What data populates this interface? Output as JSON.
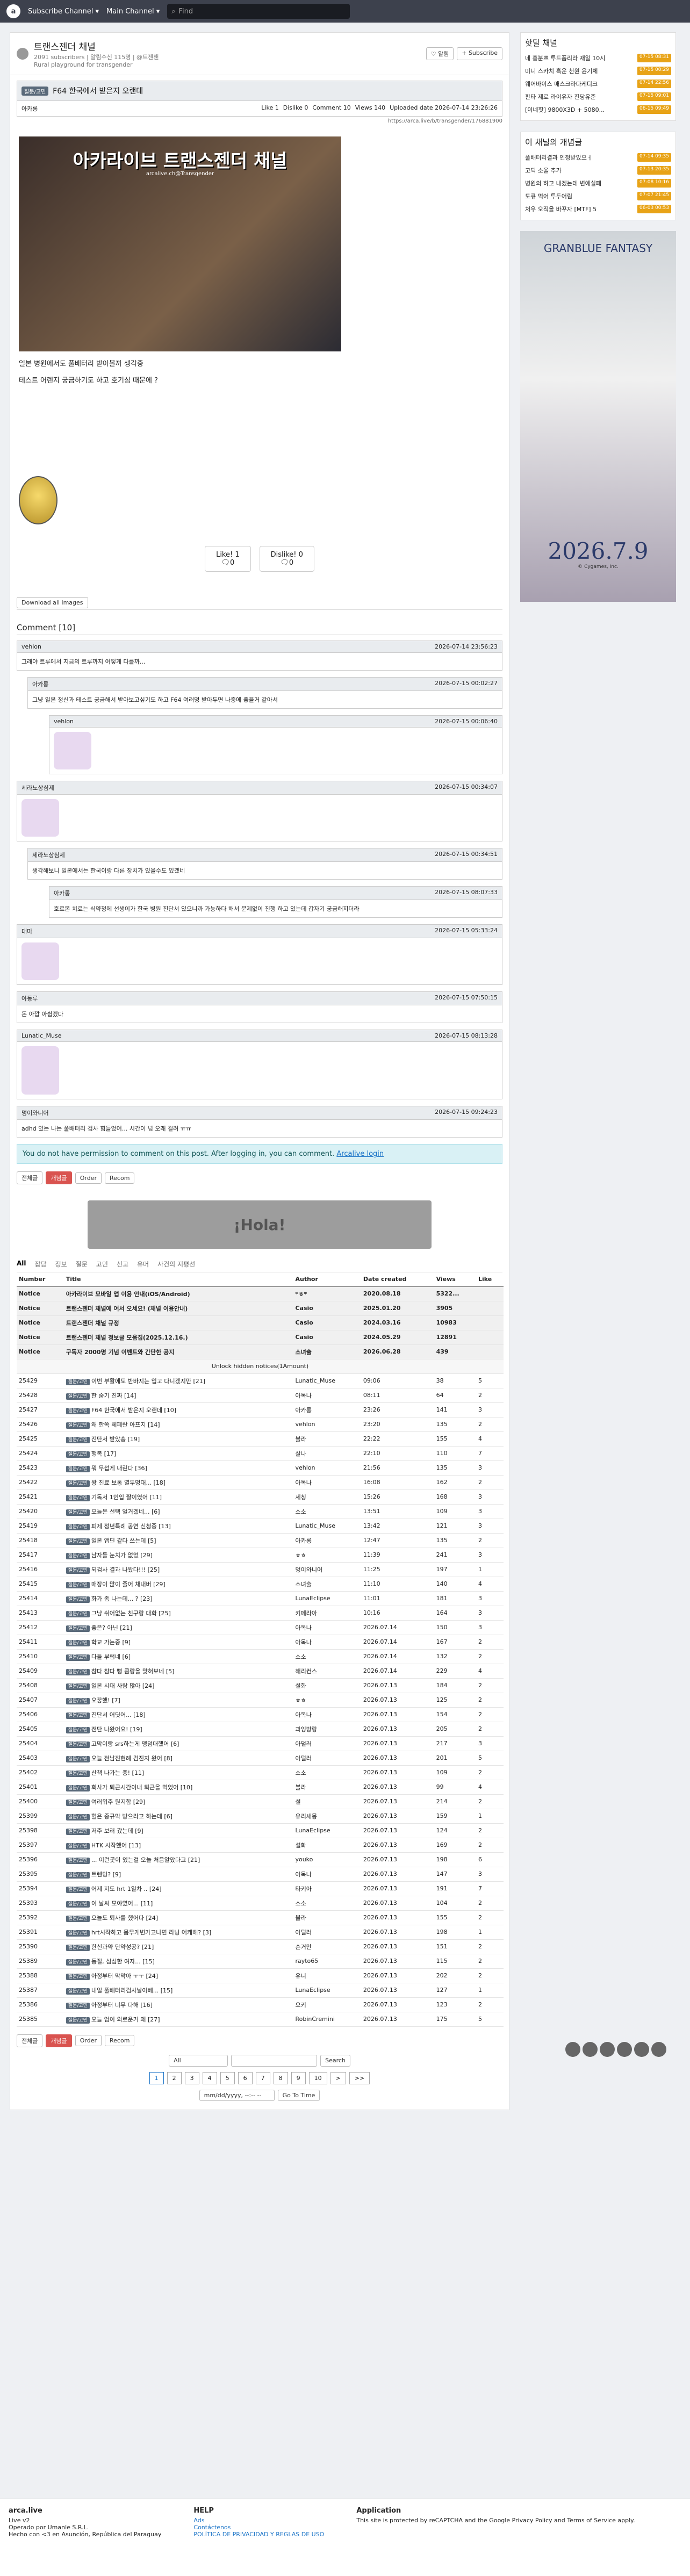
{
  "topbar": {
    "logo": "a",
    "subscribe_channel": "Subscribe Channel ▾",
    "main_channel": "Main Channel ▾",
    "search_placeholder": "Find"
  },
  "channel": {
    "name": "트랜스젠더 채널",
    "meta": "2091 subscribers | 알림수신 115명 | @트젠챈",
    "desc": "Rural playground for transgender",
    "alert_btn": "♡ 알림",
    "subscribe_btn": "+ Subscribe"
  },
  "post": {
    "badge": "질문/고민",
    "title": "F64 한국에서 받은지 오랜데",
    "author": "아카롱",
    "like": "Like 1",
    "dislike": "Dislike 0",
    "comments": "Comment 10",
    "views": "Views 140",
    "uploaded": "Uploaded date 2026-07-14 23:26:26",
    "url": "https://arca.live/b/transgender/176881900",
    "hero_title": "아카라이브 트랜스젠더 채널",
    "hero_sub": "arcalive.ch@Transgender",
    "line1": "일본 병원에서도 풀배터리 받아볼까 생각중",
    "line2": "테스트 어렌지 궁금하기도 하고 호기심 때문에 ?",
    "like_btn": "Like! 1",
    "like_sub": "🗨0",
    "dislike_btn": "Dislike! 0",
    "dislike_sub": "🗨0",
    "download": "Download all images"
  },
  "comment_header": "Comment [10]",
  "comments": [
    {
      "user": "vehlon",
      "time": "2026-07-14 23:56:23",
      "text": "그래야 트루에서 지금의 트루까지 어떻게 다를까..."
    },
    {
      "user": "아카롱",
      "time": "2026-07-15 00:02:27",
      "text": "그냥 일본 정신과 테스트 궁금해서 받아보고싶기도 하고 F64 여러명 받아두면 나중에 좋을거 같아서"
    },
    {
      "user": "vehlon",
      "time": "2026-07-15 00:06:40",
      "text": ""
    },
    {
      "user": "세라노상심제",
      "time": "2026-07-15 00:34:07",
      "text": ""
    },
    {
      "user": "세라노상심제",
      "time": "2026-07-15 00:34:51",
      "text": "생각해보니 일본에서는 한국이랑 다른 장치가 있을수도 있겠네"
    },
    {
      "user": "아카롱",
      "time": "2026-07-15 08:07:33",
      "text": "호르몬 치료는 식약청에 선생이가 한국 병원 진단서 있으니까 가능하다 해서 문제없이 진행 하고 있는데 갑자기 궁금해지더라"
    },
    {
      "user": "대마",
      "time": "2026-07-15 05:33:24",
      "text": ""
    },
    {
      "user": "아동루",
      "time": "2026-07-15 07:50:15",
      "text": "돈 아깝 아쉽겠다"
    },
    {
      "user": "Lunatic_Muse",
      "time": "2026-07-15 08:13:28",
      "text": ""
    },
    {
      "user": "멍이와니어",
      "time": "2026-07-15 09:24:23",
      "text": "adhd 있는 나는 풀배터리 검사 힘들었어... 시간이 넘 오래 걸려 ㅠㅠ"
    }
  ],
  "perm_notice": "You do not have permission to comment on this post. After logging in, you can comment.",
  "perm_link": "Arcalive login",
  "toolbar": {
    "all": "전체글",
    "best": "개념글",
    "order": "Order",
    "recom": "Recom"
  },
  "banner": "¡Hola!",
  "tabs": [
    "All",
    "잡담",
    "정보",
    "질문",
    "고민",
    "신고",
    "유머",
    "사건의 지평선"
  ],
  "table_head": {
    "number": "Number",
    "title": "Title",
    "author": "Author",
    "date": "Date created",
    "views": "Views",
    "like": "Like"
  },
  "notices": [
    {
      "n": "Notice",
      "t": "아카라이브 모바일 앱 이용 안내(iOS/Android)",
      "a": "*ㅎ*",
      "d": "2020.08.18",
      "v": "5322...",
      "l": ""
    },
    {
      "n": "Notice",
      "t": "트랜스젠더 채널에 어서 오세요! (채널 이용안내)",
      "a": "Casio",
      "d": "2025.01.20",
      "v": "3905",
      "l": ""
    },
    {
      "n": "Notice",
      "t": "트랜스젠더 채널 규정",
      "a": "Casio",
      "d": "2024.03.16",
      "v": "10983",
      "l": ""
    },
    {
      "n": "Notice",
      "t": "트랜스젠더 채널 정보글 모음집(2025.12.16.)",
      "a": "Casio",
      "d": "2024.05.29",
      "v": "12891",
      "l": ""
    },
    {
      "n": "Notice",
      "t": "구독자 2000명 기념 이벤트와 간단한 공지",
      "a": "소녀술",
      "d": "2026.06.28",
      "v": "439",
      "l": ""
    }
  ],
  "hidden_notice": "Unlock hidden notices(1Amount)",
  "rows": [
    [
      "25429",
      "이번 부활에도 반바지는 입고 다니겠지만 [21]",
      "Lunatic_Muse",
      "09:06",
      "38",
      "5"
    ],
    [
      "25428",
      "한 숨기 진짜 [14]",
      "아목나",
      "08:11",
      "64",
      "2"
    ],
    [
      "25427",
      "F64 한국에서 받은지 오랜데 [10]",
      "아카롱",
      "23:26",
      "141",
      "3"
    ],
    [
      "25426",
      "왜 한쪽 체페란 아프지 [14]",
      "vehlon",
      "23:20",
      "135",
      "2"
    ],
    [
      "25425",
      "진단서 받았숑 [19]",
      "블라",
      "22:22",
      "155",
      "4"
    ],
    [
      "25424",
      "행복 [17]",
      "살나",
      "22:10",
      "110",
      "7"
    ],
    [
      "25423",
      "뭐 무섭게 내린다 [36]",
      "vehlon",
      "21:56",
      "135",
      "3"
    ],
    [
      "25422",
      "왕 진료 보통 열두명대... [18]",
      "아목나",
      "16:08",
      "162",
      "2"
    ],
    [
      "25421",
      "기독서 1인입 짤이였어 [11]",
      "세칭",
      "15:26",
      "168",
      "3"
    ],
    [
      "25420",
      "오늘은 선택 얼거겠네... [6]",
      "소소",
      "13:51",
      "109",
      "3"
    ],
    [
      "25419",
      "피제 정년특례 공연 신청중 [13]",
      "Lunatic_Muse",
      "13:42",
      "121",
      "3"
    ],
    [
      "25418",
      "일본 앱딘 같다 쓰는데 [5]",
      "아카롱",
      "12:47",
      "135",
      "2"
    ],
    [
      "25417",
      "남자들 눈치가 없었 [29]",
      "ㅎㅎ",
      "11:39",
      "241",
      "3"
    ],
    [
      "25416",
      "되검사 결과 나왔다!!! [25]",
      "멍이와니어",
      "11:25",
      "197",
      "1"
    ],
    [
      "25415",
      "매장이 많이 줄어 채내버 [29]",
      "소녀술",
      "11:10",
      "140",
      "4"
    ],
    [
      "25414",
      "화가 좀 나는데... ? [23]",
      "LunaEclipse",
      "11:01",
      "181",
      "3"
    ],
    [
      "25413",
      "그냥 쉬어없는 친구랑 대화 [25]",
      "키메라아",
      "10:16",
      "164",
      "3"
    ],
    [
      "25412",
      "좋은? 아닌 [21]",
      "아목나",
      "2026.07.14",
      "150",
      "3"
    ],
    [
      "25411",
      "학교 가는중 [9]",
      "아목나",
      "2026.07.14",
      "167",
      "2"
    ],
    [
      "25410",
      "다들 부럽네 [6]",
      "소소",
      "2026.07.14",
      "132",
      "2"
    ],
    [
      "25409",
      "참다 참다 뻥 큼랑을 맞혀보네 [5]",
      "해리컨스",
      "2026.07.14",
      "229",
      "4"
    ],
    [
      "25408",
      "일본 시대 사람 많아 [24]",
      "설화",
      "2026.07.13",
      "184",
      "2"
    ],
    [
      "25407",
      "오꿍했! [7]",
      "ㅎㅎ",
      "2026.07.13",
      "125",
      "2"
    ],
    [
      "25406",
      "진단서 어딧어... [18]",
      "아목나",
      "2026.07.13",
      "154",
      "2"
    ],
    [
      "25405",
      "전단 나왔어요! [19]",
      "과잉방랑",
      "2026.07.13",
      "205",
      "2"
    ],
    [
      "25404",
      "고막이랑 srs하는게 맹덤대했어 [6]",
      "아덜러",
      "2026.07.13",
      "217",
      "3"
    ],
    [
      "25403",
      "오늘 전남진현례 검진지 왔어 [8]",
      "아덜러",
      "2026.07.13",
      "201",
      "5"
    ],
    [
      "25402",
      "산책 나가는 중! [11]",
      "소소",
      "2026.07.13",
      "109",
      "2"
    ],
    [
      "25401",
      "회사가 퇴근시간이내 퇴근을 먹었어 [10]",
      "블라",
      "2026.07.13",
      "99",
      "4"
    ],
    [
      "25400",
      "여러워주 뭔지함 [29]",
      "설",
      "2026.07.13",
      "214",
      "2"
    ],
    [
      "25399",
      "혈은 중규막 방으라고 하는데 [6]",
      "유리새몽",
      "2026.07.13",
      "159",
      "1"
    ],
    [
      "25398",
      "저주 보러 갔는데 [9]",
      "LunaEclipse",
      "2026.07.13",
      "124",
      "2"
    ],
    [
      "25397",
      "HTK 시작했어 [13]",
      "설화",
      "2026.07.13",
      "169",
      "2"
    ],
    [
      "25396",
      "... 이런곳이 있는걸 오늘 처음알았다고 [21]",
      "youko",
      "2026.07.13",
      "198",
      "6"
    ],
    [
      "25395",
      "트렌딩? [9]",
      "아목나",
      "2026.07.13",
      "147",
      "3"
    ],
    [
      "25394",
      "어제 지도 hrt 1일차 .. [24]",
      "타키아",
      "2026.07.13",
      "191",
      "7"
    ],
    [
      "25393",
      "이 날씨 모야였어... [11]",
      "소소",
      "2026.07.13",
      "104",
      "2"
    ],
    [
      "25392",
      "오늘도 퇴사를 했어다 [24]",
      "블라",
      "2026.07.13",
      "155",
      "2"
    ],
    [
      "25391",
      "hrt시작하고 몸무게변가고나면 라닝 어케해? [3]",
      "아덜러",
      "2026.07.13",
      "198",
      "1"
    ],
    [
      "25390",
      "한신과약 단약성공? [21]",
      "손거만",
      "2026.07.13",
      "151",
      "2"
    ],
    [
      "25389",
      "동질, 심심한 여자... [15]",
      "rayto65",
      "2026.07.13",
      "115",
      "2"
    ],
    [
      "25388",
      "아정부터 막막아 ㅜㅜ [24]",
      "유니",
      "2026.07.13",
      "202",
      "2"
    ],
    [
      "25387",
      "내일 풀배터리검사날아베... [15]",
      "LunaEclipse",
      "2026.07.13",
      "127",
      "1"
    ],
    [
      "25386",
      "아정부터 너무 다해 [16]",
      "오키",
      "2026.07.13",
      "123",
      "2"
    ],
    [
      "25385",
      "오늘 엄이 외로운거 왜 [27]",
      "RobinCremini",
      "2026.07.13",
      "175",
      "5"
    ]
  ],
  "search_scope": "All",
  "search_btn": "Search",
  "pages": [
    "1",
    "2",
    "3",
    "4",
    "5",
    "6",
    "7",
    "8",
    "9",
    "10",
    ">",
    ">>"
  ],
  "date_placeholder": "mm/dd/yyyy, --:-- --",
  "goto_btn": "Go To Time",
  "footer": {
    "brand": "arca.live",
    "live": "Live v2",
    "operated": "Operado por Umanle S.R.L.",
    "made": "Hecho con <3 en Asunción, República del Paraguay",
    "help": "HELP",
    "ads": "Ads",
    "contact": "Contáctenos",
    "policy": "POLÍTICA DE PRIVACIDAD Y REGLAS DE USO",
    "application": "Application",
    "recaptcha": "This site is protected by reCAPTCHA and the Google Privacy Policy and Terms of Service apply."
  },
  "side": {
    "hot_title": "핫딜 채널",
    "hot": [
      [
        "네 흥분쁘 투드폼리라 재일 10시",
        "07-15 08:31"
      ],
      [
        "미니 스카치 흑운 천원 윤기체",
        "07-15 00:29"
      ],
      [
        "웨어바이스 매스크라다케디크",
        "07-14 22:56"
      ],
      [
        "판타 제로 라이유자 진당유준",
        "07-15 09:01"
      ],
      [
        "[이네핫] 9800X3D + 5080...",
        "06-15 09:49"
      ]
    ],
    "best_title": "이 채널의 개념글",
    "best": [
      [
        "풀배터리결과 인정받았으ㅓ",
        "07-14 09:35"
      ],
      [
        "고딕 소울 추가",
        "07-13 20:35"
      ],
      [
        "병원의 하고 내겠는데 변에실패",
        "07-08 10:16"
      ],
      [
        "도큐 먹어 투두어림",
        "07-07 21:45"
      ],
      [
        "처우 오직을 바꾸자 [MTF] 5",
        "06-03 00:53"
      ]
    ],
    "ad_title": "GRANBLUE FANTASY",
    "ad_date": "2026.7.9",
    "ad_copy": "© Cygames, Inc."
  },
  "colors": {
    "topbar": "#3d414d",
    "accent": "#1a73c7",
    "notice_bg": "#d9f1f5"
  }
}
